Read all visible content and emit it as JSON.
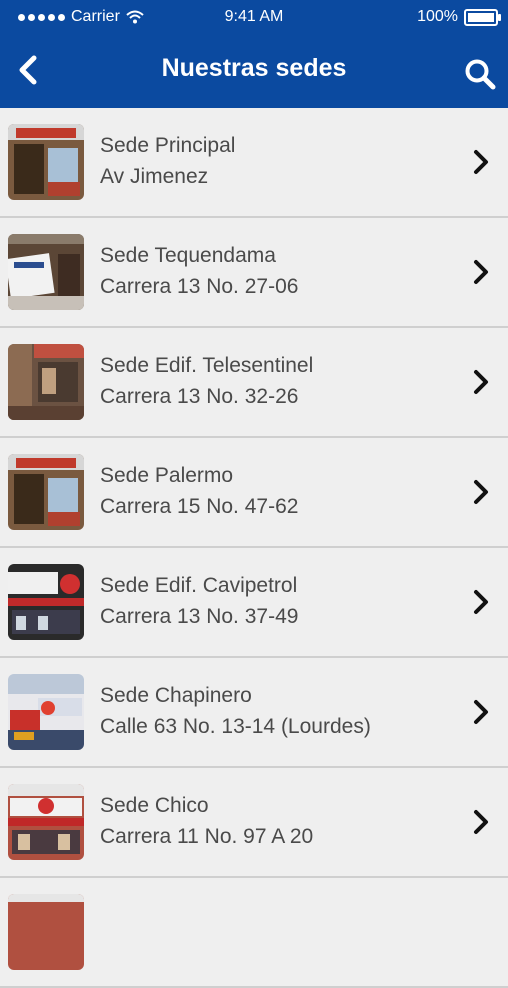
{
  "status_bar": {
    "carrier": "Carrier",
    "time": "9:41 AM",
    "battery": "100%"
  },
  "header": {
    "title": "Nuestras sedes",
    "accent_color": "#0b4aa0"
  },
  "sedes": [
    {
      "name": "Sede Principal",
      "address": "Av Jimenez"
    },
    {
      "name": "Sede Tequendama",
      "address": "Carrera 13 No. 27-06"
    },
    {
      "name": "Sede Edif. Telesentinel",
      "address": "Carrera 13 No. 32-26"
    },
    {
      "name": "Sede Palermo",
      "address": "Carrera 15 No. 47-62"
    },
    {
      "name": "Sede Edif. Cavipetrol",
      "address": "Carrera 13 No. 37-49"
    },
    {
      "name": "Sede Chapinero",
      "address": "Calle 63 No. 13-14 (Lourdes)"
    },
    {
      "name": "Sede Chico",
      "address": "Carrera 11 No. 97 A 20"
    }
  ]
}
